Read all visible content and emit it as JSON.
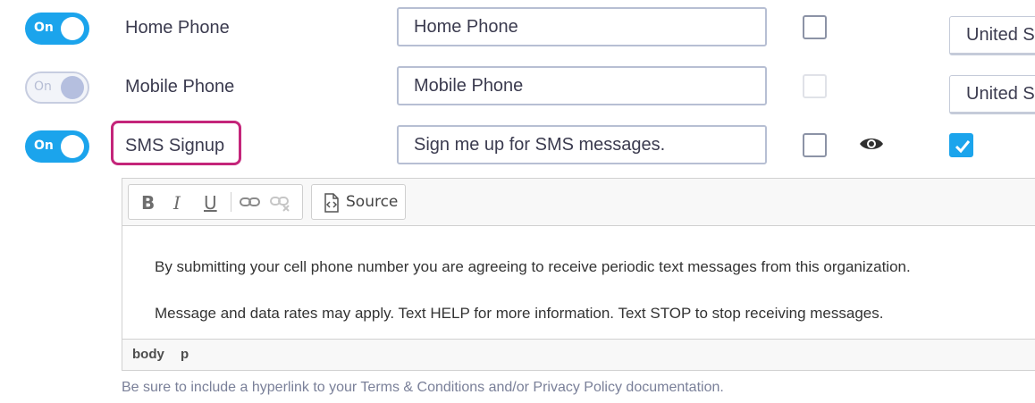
{
  "fields": [
    {
      "toggle_label": "On",
      "toggle_state": "on",
      "label": "Home Phone",
      "input_value": "Home Phone",
      "required_checkbox": "unchecked",
      "country_value": "United S"
    },
    {
      "toggle_label": "On",
      "toggle_state": "off",
      "label": "Mobile Phone",
      "input_value": "Mobile Phone",
      "required_checkbox": "disabled",
      "country_value": "United S"
    },
    {
      "toggle_label": "On",
      "toggle_state": "on",
      "label": "SMS Signup",
      "input_value": "Sign me up for SMS messages.",
      "required_checkbox": "unchecked",
      "visibility_icon": "eye-icon",
      "checked_checkbox": "checked"
    }
  ],
  "editor": {
    "toolbar": {
      "bold_label": "B",
      "italic_label": "I",
      "underline_label": "U",
      "link_icon": "link-icon",
      "unlink_icon": "unlink-icon",
      "source_icon": "source-icon",
      "source_label": "Source"
    },
    "paragraphs": [
      "By submitting your cell phone number you are agreeing to receive periodic text messages from this organization.",
      "Message and data rates may apply. Text HELP for more information. Text STOP to stop receiving messages."
    ],
    "element_path": [
      "body",
      "p"
    ]
  },
  "helper_text": "Be sure to include a hyperlink to your Terms & Conditions and/or Privacy Policy documentation.",
  "colors": {
    "accent": "#1ba4ec",
    "highlight": "#c4257a",
    "toggle_off_knob": "#b5bfdf"
  }
}
